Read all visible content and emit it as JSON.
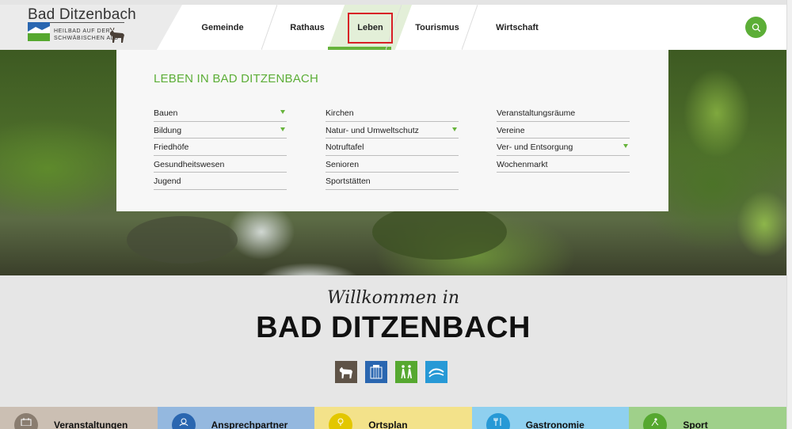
{
  "logo": {
    "title": "Bad Ditzenbach",
    "subtitle_line1": "HEILBAD AUF DER",
    "subtitle_line2": "SCHWÄBISCHEN ALB"
  },
  "nav": {
    "items": [
      {
        "label": "Gemeinde"
      },
      {
        "label": "Rathaus"
      },
      {
        "label": "Leben"
      },
      {
        "label": "Tourismus"
      },
      {
        "label": "Wirtschaft"
      }
    ],
    "active": "Leben"
  },
  "icons": {
    "search": "search-icon",
    "chevron": "chevron-down-icon"
  },
  "colors": {
    "accent": "#5cae37",
    "highlight": "#d81f26"
  },
  "dropdown": {
    "title": "LEBEN IN BAD DITZENBACH",
    "col1": [
      {
        "label": "Bauen",
        "has_sub": true
      },
      {
        "label": "Bildung",
        "has_sub": true
      },
      {
        "label": "Friedhöfe",
        "has_sub": false
      },
      {
        "label": "Gesundheitswesen",
        "has_sub": false
      },
      {
        "label": "Jugend",
        "has_sub": false
      }
    ],
    "col2": [
      {
        "label": "Kirchen",
        "has_sub": false
      },
      {
        "label": "Natur- und Umweltschutz",
        "has_sub": true
      },
      {
        "label": "Notruftafel",
        "has_sub": false
      },
      {
        "label": "Senioren",
        "has_sub": false
      },
      {
        "label": "Sportstätten",
        "has_sub": false
      }
    ],
    "col3": [
      {
        "label": "Veranstaltungsräume",
        "has_sub": false
      },
      {
        "label": "Vereine",
        "has_sub": false
      },
      {
        "label": "Ver- und Entsorgung",
        "has_sub": true
      },
      {
        "label": "Wochenmarkt",
        "has_sub": false
      }
    ]
  },
  "welcome": {
    "script": "Willkommen in",
    "title": "BAD DITZENBACH"
  },
  "badges": [
    {
      "icon": "goat-icon",
      "color": "#5f5347"
    },
    {
      "icon": "building-icon",
      "color": "#2a66b0"
    },
    {
      "icon": "hikers-icon",
      "color": "#56a830"
    },
    {
      "icon": "wave-icon",
      "color": "#2799d6"
    }
  ],
  "tiles": [
    {
      "label": "Veranstaltungen",
      "bg": "#cbbfb3",
      "icon_bg": "#8a7d70",
      "icon": "calendar-icon"
    },
    {
      "label": "Ansprechpartner",
      "bg": "#94b8df",
      "icon_bg": "#2a66b0",
      "icon": "person-icon"
    },
    {
      "label": "Ortsplan",
      "bg": "#f3e28a",
      "icon_bg": "#e3c700",
      "icon": "map-pin-icon"
    },
    {
      "label": "Gastronomie",
      "bg": "#8fd0ef",
      "icon_bg": "#2799d6",
      "icon": "cutlery-icon"
    },
    {
      "label": "Sport",
      "bg": "#9fd08a",
      "icon_bg": "#56a830",
      "icon": "runner-icon"
    }
  ]
}
